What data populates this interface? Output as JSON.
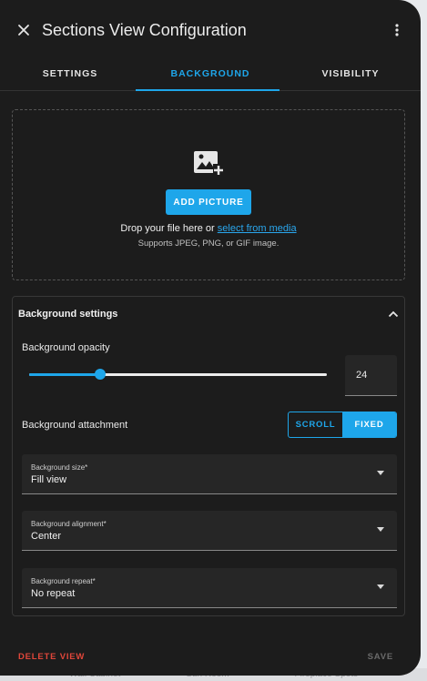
{
  "dialog": {
    "title": "Sections View Configuration",
    "close_icon": "close-icon",
    "menu_icon": "more-vert-icon"
  },
  "tabs": [
    {
      "label": "SETTINGS",
      "active": false
    },
    {
      "label": "BACKGROUND",
      "active": true
    },
    {
      "label": "VISIBILITY",
      "active": false
    }
  ],
  "upload": {
    "icon": "image-plus-icon",
    "button_label": "ADD PICTURE",
    "drop_text": "Drop your file here or",
    "link_text": "select from media",
    "hint": "Supports JPEG, PNG, or GIF image."
  },
  "background_settings": {
    "title": "Background settings",
    "collapse_icon": "chevron-up-icon",
    "opacity_label": "Background opacity",
    "opacity_value": "24",
    "opacity_level": 0.24,
    "attachment_label": "Background attachment",
    "attachment_options": [
      "SCROLL",
      "FIXED"
    ],
    "attachment_selected": "FIXED",
    "size": {
      "label": "Background size*",
      "value": "Fill view"
    },
    "alignment": {
      "label": "Background alignment*",
      "value": "Center"
    },
    "repeat": {
      "label": "Background repeat*",
      "value": "No repeat"
    }
  },
  "footer": {
    "delete_label": "DELETE VIEW",
    "save_label": "SAVE"
  },
  "behind": {
    "items": [
      "Wall Cabinet",
      "Sun Room",
      "Fireplace Spots"
    ]
  },
  "colors": {
    "accent": "#1ea6ea",
    "danger": "#e0463a",
    "surface": "#1c1c1c"
  }
}
